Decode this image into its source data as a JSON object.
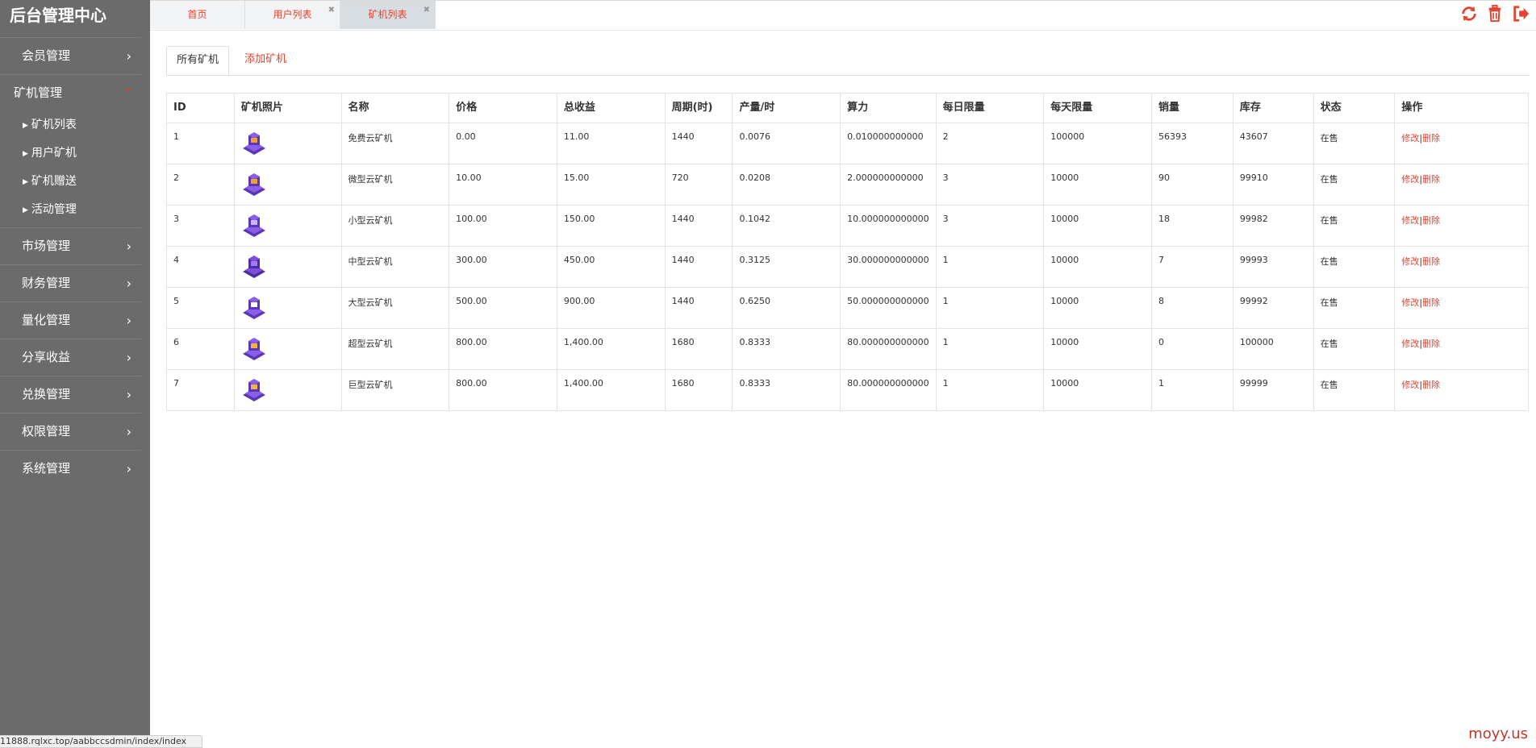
{
  "sidebar": {
    "brand": "后台管理中心",
    "items": [
      {
        "label": "会员管理"
      },
      {
        "label": "矿机管理",
        "open": true,
        "sub": [
          "矿机列表",
          "用户矿机",
          "矿机赠送",
          "活动管理"
        ]
      },
      {
        "label": "市场管理"
      },
      {
        "label": "财务管理"
      },
      {
        "label": "量化管理"
      },
      {
        "label": "分享收益"
      },
      {
        "label": "兑换管理"
      },
      {
        "label": "权限管理"
      },
      {
        "label": "系统管理"
      }
    ]
  },
  "tabs": [
    {
      "label": "首页",
      "closable": false
    },
    {
      "label": "用户列表",
      "closable": true
    },
    {
      "label": "矿机列表",
      "closable": true,
      "active": true
    }
  ],
  "top_icons": [
    "refresh-icon",
    "trash-icon",
    "logout-icon"
  ],
  "content": {
    "subtabs": [
      "所有矿机",
      "添加矿机"
    ],
    "table": {
      "headers": [
        "ID",
        "矿机照片",
        "名称",
        "价格",
        "总收益",
        "周期(时)",
        "产量/时",
        "算力",
        "每日限量",
        "每天限量",
        "销量",
        "库存",
        "状态",
        "操作"
      ],
      "rows": [
        {
          "id": "1",
          "name": "免费云矿机",
          "price": "0.00",
          "total": "11.00",
          "cycle": "1440",
          "output": "0.0076",
          "hash": "0.010000000000",
          "daily": "2",
          "day_limit": "100000",
          "sales": "56393",
          "stock": "43607",
          "status": "在售",
          "icon": "miner-icon-1"
        },
        {
          "id": "2",
          "name": "微型云矿机",
          "price": "10.00",
          "total": "15.00",
          "cycle": "720",
          "output": "0.0208",
          "hash": "2.000000000000",
          "daily": "3",
          "day_limit": "10000",
          "sales": "90",
          "stock": "99910",
          "status": "在售",
          "icon": "miner-icon-2"
        },
        {
          "id": "3",
          "name": "小型云矿机",
          "price": "100.00",
          "total": "150.00",
          "cycle": "1440",
          "output": "0.1042",
          "hash": "10.000000000000",
          "daily": "3",
          "day_limit": "10000",
          "sales": "18",
          "stock": "99982",
          "status": "在售",
          "icon": "miner-icon-3"
        },
        {
          "id": "4",
          "name": "中型云矿机",
          "price": "300.00",
          "total": "450.00",
          "cycle": "1440",
          "output": "0.3125",
          "hash": "30.000000000000",
          "daily": "1",
          "day_limit": "10000",
          "sales": "7",
          "stock": "99993",
          "status": "在售",
          "icon": "miner-icon-4"
        },
        {
          "id": "5",
          "name": "大型云矿机",
          "price": "500.00",
          "total": "900.00",
          "cycle": "1440",
          "output": "0.6250",
          "hash": "50.000000000000",
          "daily": "1",
          "day_limit": "10000",
          "sales": "8",
          "stock": "99992",
          "status": "在售",
          "icon": "miner-icon-5"
        },
        {
          "id": "6",
          "name": "超型云矿机",
          "price": "800.00",
          "total": "1,400.00",
          "cycle": "1680",
          "output": "0.8333",
          "hash": "80.000000000000",
          "daily": "1",
          "day_limit": "10000",
          "sales": "0",
          "stock": "100000",
          "status": "在售",
          "icon": "miner-icon-6"
        },
        {
          "id": "7",
          "name": "巨型云矿机",
          "price": "800.00",
          "total": "1,400.00",
          "cycle": "1680",
          "output": "0.8333",
          "hash": "80.000000000000",
          "daily": "1",
          "day_limit": "10000",
          "sales": "1",
          "stock": "99999",
          "status": "在售",
          "icon": "miner-icon-7"
        }
      ],
      "actions": {
        "edit": "修改",
        "sep": "|",
        "delete": "删除"
      }
    }
  },
  "statusbar": "11888.rqlxc.top/aabbccsdmin/index/index",
  "watermark": "moyy.us",
  "colors": {
    "accent": "#e5432f",
    "sidebar": "#6b6b6b",
    "tab_active": "#d8dde2",
    "tab": "#f2f3f4",
    "icon_purple": "#7b4fd6"
  }
}
